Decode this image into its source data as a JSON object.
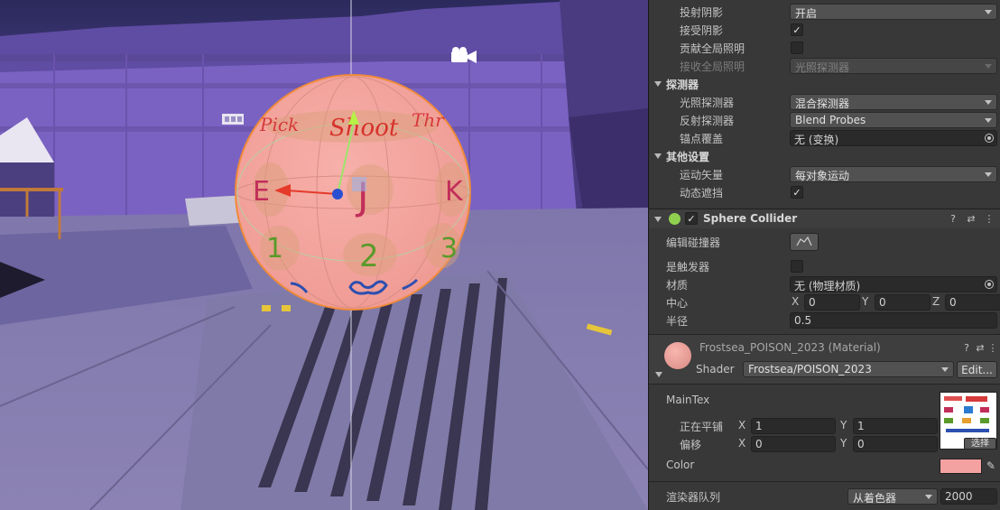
{
  "scene": {
    "ball_labels": [
      "Pick",
      "Shoot",
      "Thr",
      "E",
      "J",
      "K",
      "1",
      "2",
      "3"
    ]
  },
  "inspector": {
    "mesh_renderer": {
      "cast_shadows": {
        "label": "投射阴影",
        "value": "开启"
      },
      "receive_shadows": {
        "label": "接受阴影",
        "checked": true
      },
      "contribute_gi": {
        "label": "贡献全局照明",
        "checked": false
      },
      "receive_gi": {
        "label": "接收全局照明",
        "value": "光照探测器"
      },
      "probes_section": "探测器",
      "light_probes": {
        "label": "光照探测器",
        "value": "混合探测器"
      },
      "reflection_probes": {
        "label": "反射探测器",
        "value": "Blend Probes"
      },
      "anchor_override": {
        "label": "锚点覆盖",
        "value": "无 (变换)"
      },
      "other_section": "其他设置",
      "motion_vectors": {
        "label": "运动矢量",
        "value": "每对象运动"
      },
      "dynamic_occlusion": {
        "label": "动态遮挡",
        "checked": true
      }
    },
    "sphere_collider": {
      "title": "Sphere Collider",
      "edit_collider": "编辑碰撞器",
      "is_trigger": {
        "label": "是触发器",
        "checked": false
      },
      "material": {
        "label": "材质",
        "value": "无 (物理材质)"
      },
      "center": {
        "label": "中心",
        "x": "0",
        "y": "0",
        "z": "0"
      },
      "radius": {
        "label": "半径",
        "value": "0.5"
      }
    },
    "material": {
      "title": "Frostsea_POISON_2023 (Material)",
      "shader_label": "Shader",
      "shader_value": "Frostsea/POISON_2023",
      "edit_button": "Edit...",
      "maintex_label": "MainTex",
      "tiling": {
        "label": "正在平铺",
        "x": "1",
        "y": "1"
      },
      "offset": {
        "label": "偏移",
        "x": "0",
        "y": "0"
      },
      "select_button": "选择",
      "color_label": "Color",
      "color_value": "#f4a1a1",
      "render_queue": {
        "label": "渲染器队列",
        "mode": "从着色器",
        "value": "2000"
      }
    },
    "axis": {
      "x": "X",
      "y": "Y",
      "z": "Z"
    }
  },
  "colors": {
    "accent_ball": "#f4a3a0",
    "scene_sky": "#3a2f6f",
    "scene_wall": "#7d62c4",
    "inspector_bg": "#383838"
  }
}
